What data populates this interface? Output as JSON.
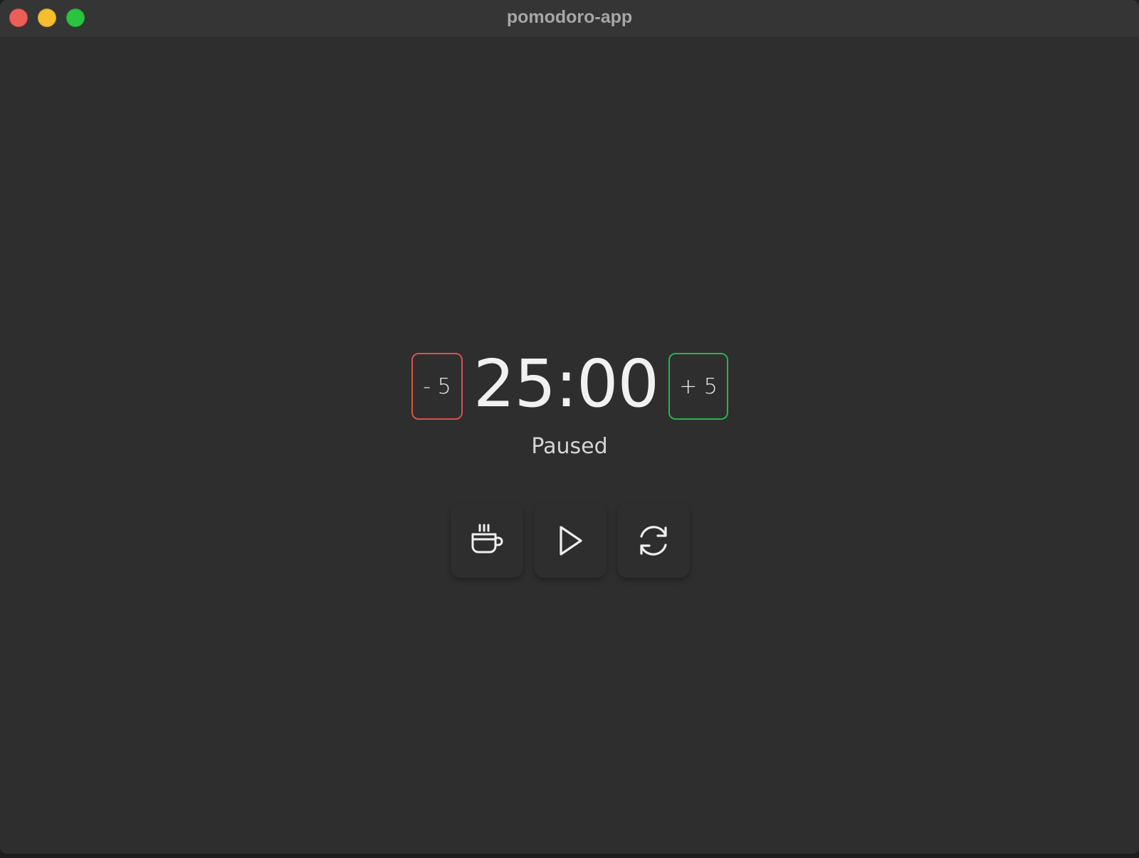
{
  "window": {
    "title": "pomodoro-app"
  },
  "timer": {
    "minus_label": "- 5",
    "plus_label": "+ 5",
    "time": "25:00",
    "status": "Paused"
  },
  "controls": {
    "break_icon": "coffee-cup-icon",
    "play_icon": "play-icon",
    "reset_icon": "reset-icon"
  },
  "colors": {
    "minus_border": "#d9534b",
    "plus_border": "#27b548",
    "background": "#2e2e2e",
    "titlebar": "#353535"
  }
}
